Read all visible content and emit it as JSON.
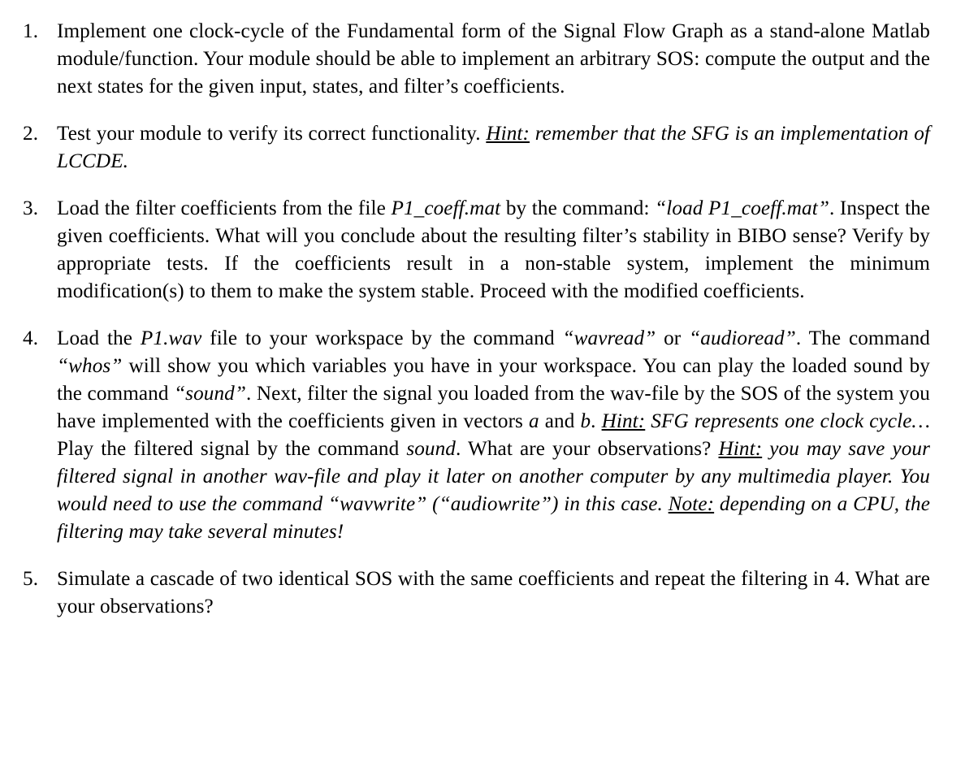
{
  "document": {
    "background_color": "#ffffff",
    "text_color": "#000000",
    "items": [
      {
        "number": "1.",
        "name": "task-item-1",
        "runs": [
          {
            "style": "normal",
            "text": "Implement one clock-cycle of the Fundamental form of the Signal Flow Graph as a stand-alone Matlab module/function. Your module should be able to implement an arbitrary SOS: compute the output and the next states for the given input, states, and filter’s coefficients."
          }
        ]
      },
      {
        "number": "2.",
        "name": "task-item-2",
        "runs": [
          {
            "style": "normal",
            "text": "Test your module to verify its correct functionality. "
          },
          {
            "style": "underline-italic",
            "text": "Hint:"
          },
          {
            "style": "italic",
            "text": " remember that the SFG is an implementation of LCCDE."
          }
        ]
      },
      {
        "number": "3.",
        "name": "task-item-3",
        "runs": [
          {
            "style": "normal",
            "text": "Load the filter coefficients from the file "
          },
          {
            "style": "italic",
            "text": "P1_coeff.mat"
          },
          {
            "style": "normal",
            "text": " by the command: "
          },
          {
            "style": "italic",
            "text": "“load P1_coeff.mat”"
          },
          {
            "style": "normal",
            "text": ". Inspect the given coefficients. What will you conclude about the resulting filter’s stability in BIBO sense? Verify by appropriate tests. If the coefficients result in a non-stable system, implement the minimum modification(s) to them to make the system stable. Proceed with the modified coefficients."
          }
        ]
      },
      {
        "number": "4.",
        "name": "task-item-4",
        "runs": [
          {
            "style": "normal",
            "text": "Load the "
          },
          {
            "style": "italic",
            "text": "P1.wav"
          },
          {
            "style": "normal",
            "text": " file to your workspace by the command "
          },
          {
            "style": "italic",
            "text": "“wavread”"
          },
          {
            "style": "normal",
            "text": " or "
          },
          {
            "style": "italic",
            "text": "“audioread”"
          },
          {
            "style": "normal",
            "text": ". The command "
          },
          {
            "style": "italic",
            "text": "“whos”"
          },
          {
            "style": "normal",
            "text": " will show you which variables you have in your workspace. You can play the loaded sound by the command "
          },
          {
            "style": "italic",
            "text": "“sound”"
          },
          {
            "style": "normal",
            "text": ". Next, filter the signal you loaded from the wav-file by the SOS of the system you have implemented with the coefficients given in vectors "
          },
          {
            "style": "italic",
            "text": "a"
          },
          {
            "style": "normal",
            "text": " and "
          },
          {
            "style": "italic",
            "text": "b"
          },
          {
            "style": "normal",
            "text": ". "
          },
          {
            "style": "underline-italic",
            "text": "Hint:"
          },
          {
            "style": "italic",
            "text": " SFG represents one clock cycle…"
          },
          {
            "style": "normal",
            "text": "Play the filtered signal by the command "
          },
          {
            "style": "italic",
            "text": "sound"
          },
          {
            "style": "normal",
            "text": ". What are your observations? "
          },
          {
            "style": "underline-italic",
            "text": "Hint:"
          },
          {
            "style": "italic",
            "text": " you may save your filtered signal in another wav-file and play it later on another computer by any multimedia player. You would need to use the command “wavwrite” (“audiowrite”) in this case. "
          },
          {
            "style": "underline-italic",
            "text": "Note:"
          },
          {
            "style": "italic",
            "text": " depending on a CPU, the filtering may take several minutes!"
          }
        ]
      },
      {
        "number": "5.",
        "name": "task-item-5",
        "runs": [
          {
            "style": "normal",
            "text": "Simulate a cascade of two identical SOS with the same coefficients and repeat the filtering in 4. What are your observations?"
          }
        ]
      }
    ]
  }
}
